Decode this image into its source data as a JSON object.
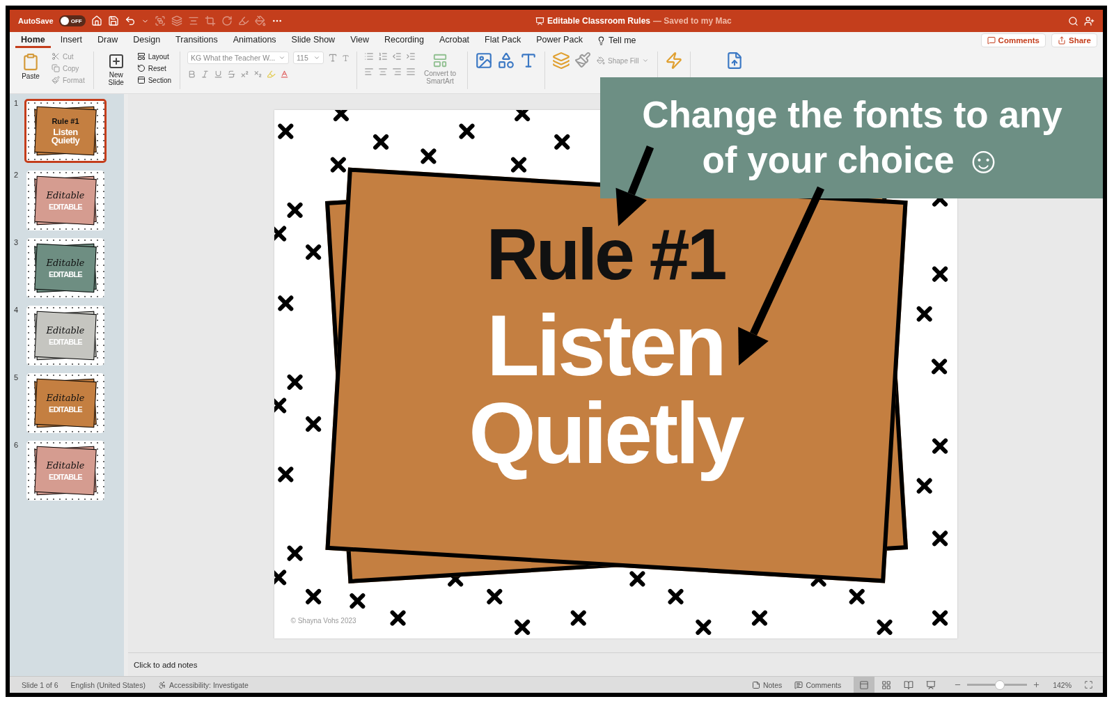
{
  "title_bar": {
    "autosave_label": "AutoSave",
    "autosave": {
      "on": false,
      "label": "OFF"
    },
    "document_title": "Editable Classroom Rules",
    "save_status": "— Saved to my Mac"
  },
  "tabs": [
    {
      "label": "Home",
      "selected": true
    },
    {
      "label": "Insert",
      "selected": false
    },
    {
      "label": "Draw",
      "selected": false
    },
    {
      "label": "Design",
      "selected": false
    },
    {
      "label": "Transitions",
      "selected": false
    },
    {
      "label": "Animations",
      "selected": false
    },
    {
      "label": "Slide Show",
      "selected": false
    },
    {
      "label": "View",
      "selected": false
    },
    {
      "label": "Recording",
      "selected": false
    },
    {
      "label": "Acrobat",
      "selected": false
    },
    {
      "label": "Flat Pack",
      "selected": false
    },
    {
      "label": "Power Pack",
      "selected": false
    }
  ],
  "tell_me": "Tell me",
  "header_buttons": [
    "Comments",
    "Share"
  ],
  "ribbon": {
    "paste": "Paste",
    "cut": "Cut",
    "copy": "Copy",
    "format": "Format",
    "new_slide": "New Slide",
    "layout": "Layout",
    "reset": "Reset",
    "section": "Section",
    "font_name": "KG What the Teacher W...",
    "font_size": "115",
    "convert": "Convert to SmartArt",
    "shape_fill": "Shape Fill"
  },
  "thumbnails": [
    {
      "number": "1",
      "selected": true,
      "color": "#c47f41",
      "kind": "rule",
      "title": "Rule #1",
      "text": "Listen Quietly"
    },
    {
      "number": "2",
      "selected": false,
      "color": "#d59c90",
      "kind": "editable",
      "title": "Editable",
      "text": "EDITABLE"
    },
    {
      "number": "3",
      "selected": false,
      "color": "#6e8e82",
      "kind": "editable",
      "title": "Editable",
      "text": "EDITABLE"
    },
    {
      "number": "4",
      "selected": false,
      "color": "#c5c5c0",
      "kind": "editable",
      "title": "Editable",
      "text": "EDITABLE"
    },
    {
      "number": "5",
      "selected": false,
      "color": "#c47f41",
      "kind": "editable",
      "title": "Editable",
      "text": "EDITABLE"
    },
    {
      "number": "6",
      "selected": false,
      "color": "#d59c90",
      "kind": "editable",
      "title": "Editable",
      "text": "EDITABLE"
    }
  ],
  "slide": {
    "title": "Rule #1",
    "text": "Listen Quietly",
    "copyright": "© Shayna Vohs 2023"
  },
  "callout": "Change the fonts to any of your choice ☺",
  "notes_placeholder": "Click to add notes",
  "status_bar": {
    "slide": "Slide 1 of 6",
    "language": "English (United States)",
    "accessibility": "Accessibility: Investigate",
    "notes": "Notes",
    "comments": "Comments",
    "views": [
      {
        "kind": "normal",
        "selected": true
      },
      {
        "kind": "sorter",
        "selected": false
      },
      {
        "kind": "reading",
        "selected": false
      },
      {
        "kind": "show",
        "selected": false
      }
    ],
    "zoom": {
      "level": 0.55,
      "label": "142%"
    }
  }
}
